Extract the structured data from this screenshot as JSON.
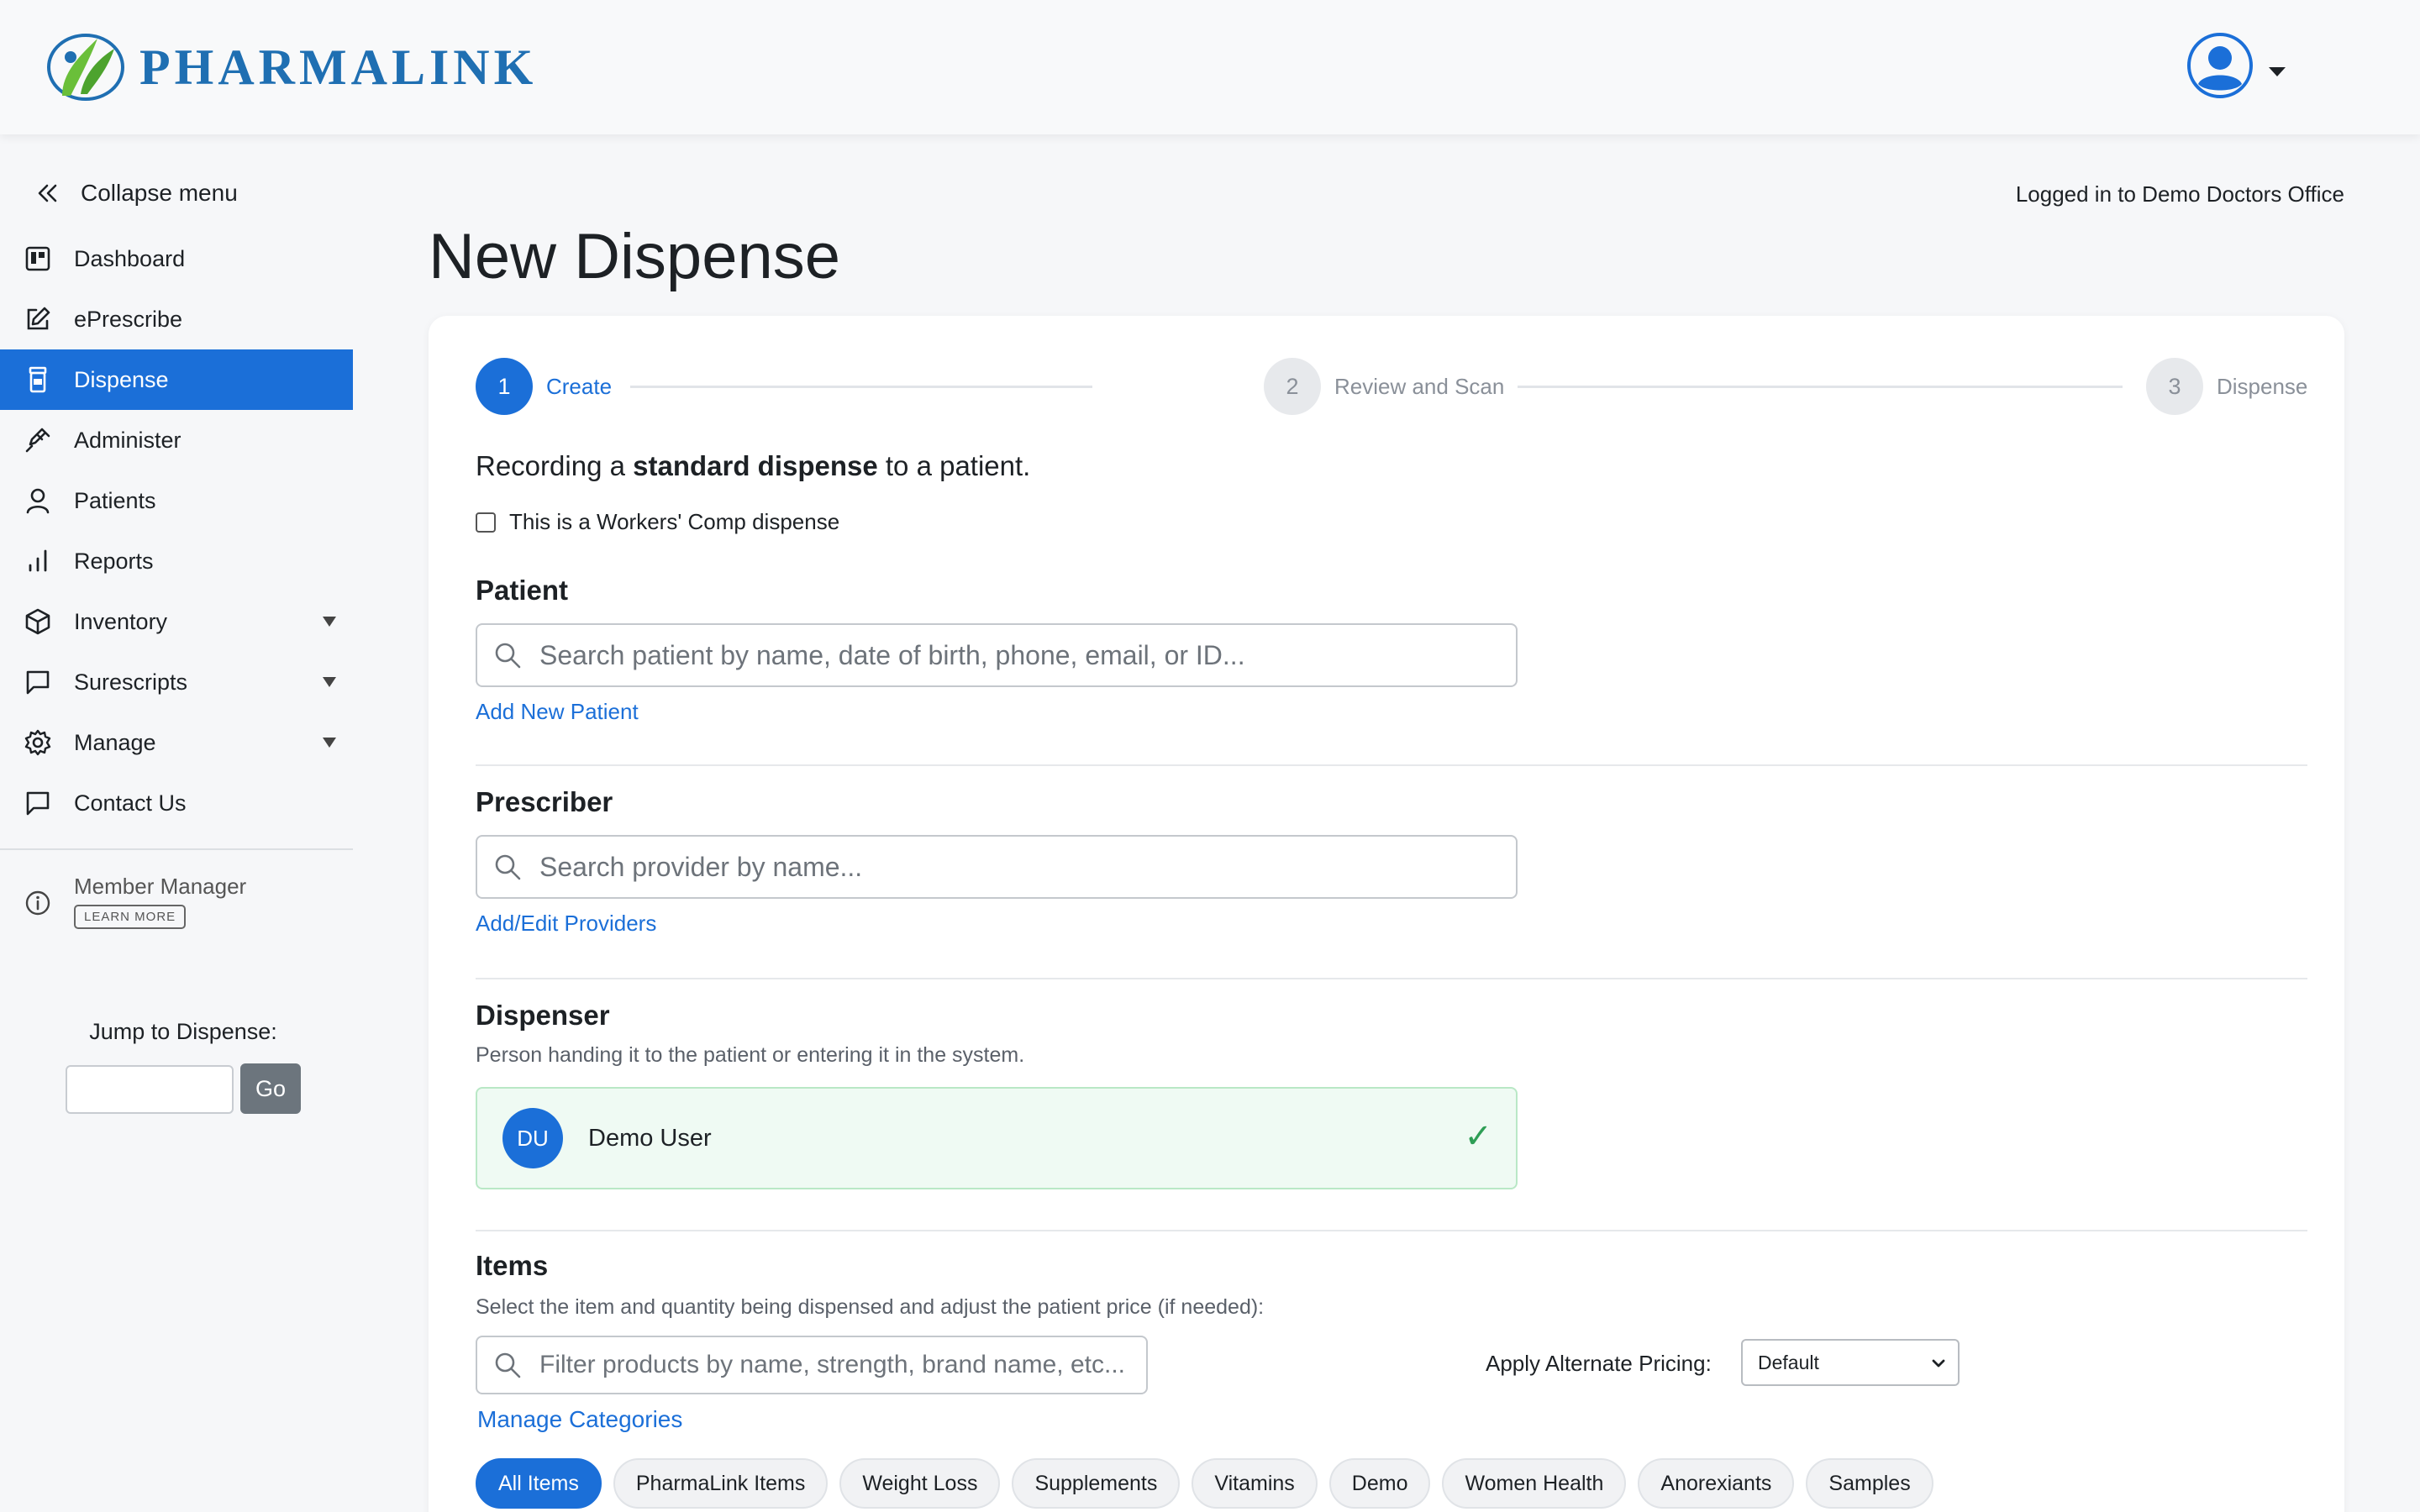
{
  "header": {
    "brand": "PHARMALINK"
  },
  "sidebar": {
    "collapse_label": "Collapse menu",
    "items": [
      {
        "label": "Dashboard"
      },
      {
        "label": "ePrescribe"
      },
      {
        "label": "Dispense"
      },
      {
        "label": "Administer"
      },
      {
        "label": "Patients"
      },
      {
        "label": "Reports"
      },
      {
        "label": "Inventory"
      },
      {
        "label": "Surescripts"
      },
      {
        "label": "Manage"
      },
      {
        "label": "Contact Us"
      }
    ],
    "member": {
      "name": "Member Manager",
      "learn_more": "LEARN MORE"
    },
    "jump": {
      "label": "Jump to Dispense:",
      "value": "",
      "go_label": "Go"
    }
  },
  "main": {
    "logged_in": "Logged in to Demo Doctors Office",
    "title": "New Dispense",
    "steps": [
      {
        "number": "1",
        "label": "Create"
      },
      {
        "number": "2",
        "label": "Review and Scan"
      },
      {
        "number": "3",
        "label": "Dispense"
      }
    ],
    "recording": {
      "prefix": "Recording a",
      "emphasis": "standard dispense",
      "suffix": "to a patient."
    },
    "workers_comp_label": "This is a Workers' Comp dispense",
    "patient": {
      "title": "Patient",
      "placeholder": "Search patient by name, date of birth, phone, email, or ID...",
      "link": "Add New Patient"
    },
    "prescriber": {
      "title": "Prescriber",
      "placeholder": "Search provider by name...",
      "link": "Add/Edit Providers"
    },
    "dispenser": {
      "title": "Dispenser",
      "subtitle": "Person handing it to the patient or entering it in the system.",
      "initials": "DU",
      "name": "Demo User",
      "check": "✓"
    },
    "items": {
      "title": "Items",
      "subtitle": "Select the item and quantity being dispensed and adjust the patient price (if needed):",
      "filter_placeholder": "Filter products by name, strength, brand name, etc...",
      "manage_link": "Manage Categories",
      "alt_pricing_label": "Apply Alternate Pricing:",
      "alt_pricing_value": "Default",
      "categories": [
        "All Items",
        "PharmaLink Items",
        "Weight Loss",
        "Supplements",
        "Vitamins",
        "Demo",
        "Women Health",
        "Anorexiants",
        "Samples"
      ]
    }
  },
  "colors": {
    "accent": "#1b6fd8",
    "brand": "#1f6fb2",
    "logo_green": "#6abf3a",
    "success": "#2e9e55"
  }
}
